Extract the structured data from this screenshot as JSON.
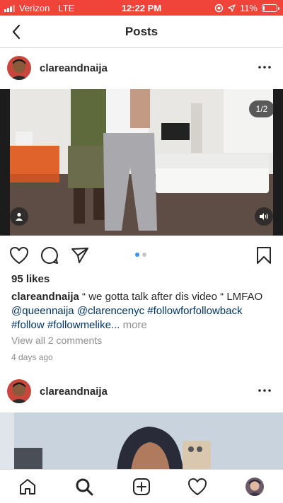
{
  "status_bar": {
    "carrier": "Verizon",
    "network": "LTE",
    "time": "12:22 PM",
    "battery": "11%",
    "battery_level": 0.11,
    "background_color": "#f0433a"
  },
  "header": {
    "title": "Posts",
    "back_icon": "chevron-left-icon"
  },
  "posts": [
    {
      "username": "clareandnaija",
      "media_counter": "1/2",
      "carousel_index": 1,
      "carousel_total": 2,
      "likes": "95 likes",
      "caption": {
        "username": "clareandnaija",
        "text": " “ we gotta talk after dis video “ LMFAO ",
        "mentions": [
          "@queennaija",
          "@clarencenyc"
        ],
        "hashtags": [
          "#followforfollowback",
          "#follow",
          "#followmelike..."
        ],
        "more": "more"
      },
      "view_comments": "View all 2 comments",
      "time_ago": "4 days ago"
    },
    {
      "username": "clareandnaija"
    }
  ],
  "tab_bar": {
    "icons": [
      "home-icon",
      "search-icon",
      "new-post-icon",
      "activity-heart-icon",
      "profile-avatar"
    ]
  },
  "colors": {
    "link": "#003569",
    "muted": "#8e8e8e",
    "carousel_active": "#3897f0",
    "carousel_inactive": "#c7c7c7"
  }
}
